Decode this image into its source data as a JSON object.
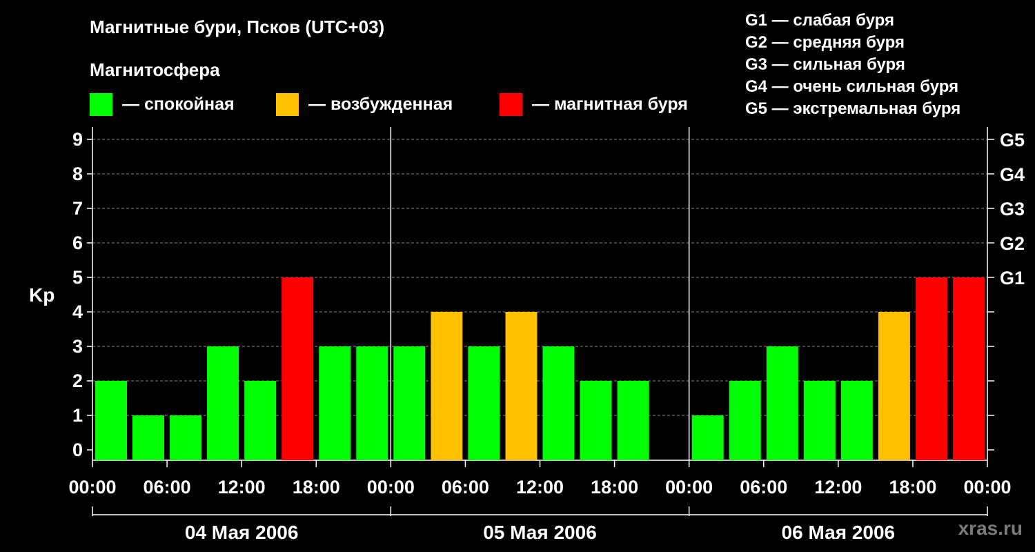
{
  "header": {
    "title": "Магнитные бури, Псков (UTC+03)",
    "subtitle": "Магнитосфера"
  },
  "legend": [
    {
      "label": "— спокойная",
      "color": "#00ff00"
    },
    {
      "label": "— возбужденная",
      "color": "#ffc000"
    },
    {
      "label": "— магнитная буря",
      "color": "#ff0000"
    }
  ],
  "g_levels": [
    "G1 — слабая буря",
    "G2 — средняя буря",
    "G3 — сильная буря",
    "G4 — очень сильная буря",
    "G5 — экстремальная буря"
  ],
  "watermark": "xras.ru",
  "chart_data": {
    "type": "bar",
    "ylabel": "Kp",
    "ylim": [
      0,
      9
    ],
    "yticks": [
      "0",
      "1",
      "2",
      "3",
      "4",
      "5",
      "6",
      "7",
      "8",
      "9"
    ],
    "right_ticks": [
      {
        "value": 5,
        "label": "G1"
      },
      {
        "value": 6,
        "label": "G2"
      },
      {
        "value": 7,
        "label": "G3"
      },
      {
        "value": 8,
        "label": "G4"
      },
      {
        "value": 9,
        "label": "G5"
      }
    ],
    "time_ticks": [
      "00:00",
      "06:00",
      "12:00",
      "18:00",
      "00:00",
      "06:00",
      "12:00",
      "18:00",
      "00:00",
      "06:00",
      "12:00",
      "18:00",
      "00:00"
    ],
    "days": [
      "04 Мая 2006",
      "05 Мая 2006",
      "06 Мая 2006"
    ],
    "values": [
      2,
      1,
      1,
      3,
      2,
      5,
      3,
      3,
      3,
      4,
      3,
      4,
      3,
      2,
      2,
      0,
      1,
      2,
      3,
      2,
      2,
      4,
      5,
      5
    ],
    "colors": [
      "#00ff00",
      "#00ff00",
      "#00ff00",
      "#00ff00",
      "#00ff00",
      "#ff0000",
      "#00ff00",
      "#00ff00",
      "#00ff00",
      "#ffc000",
      "#00ff00",
      "#ffc000",
      "#00ff00",
      "#00ff00",
      "#00ff00",
      "#00ff00",
      "#00ff00",
      "#00ff00",
      "#00ff00",
      "#00ff00",
      "#00ff00",
      "#ffc000",
      "#ff0000",
      "#ff0000"
    ],
    "grid": true
  }
}
